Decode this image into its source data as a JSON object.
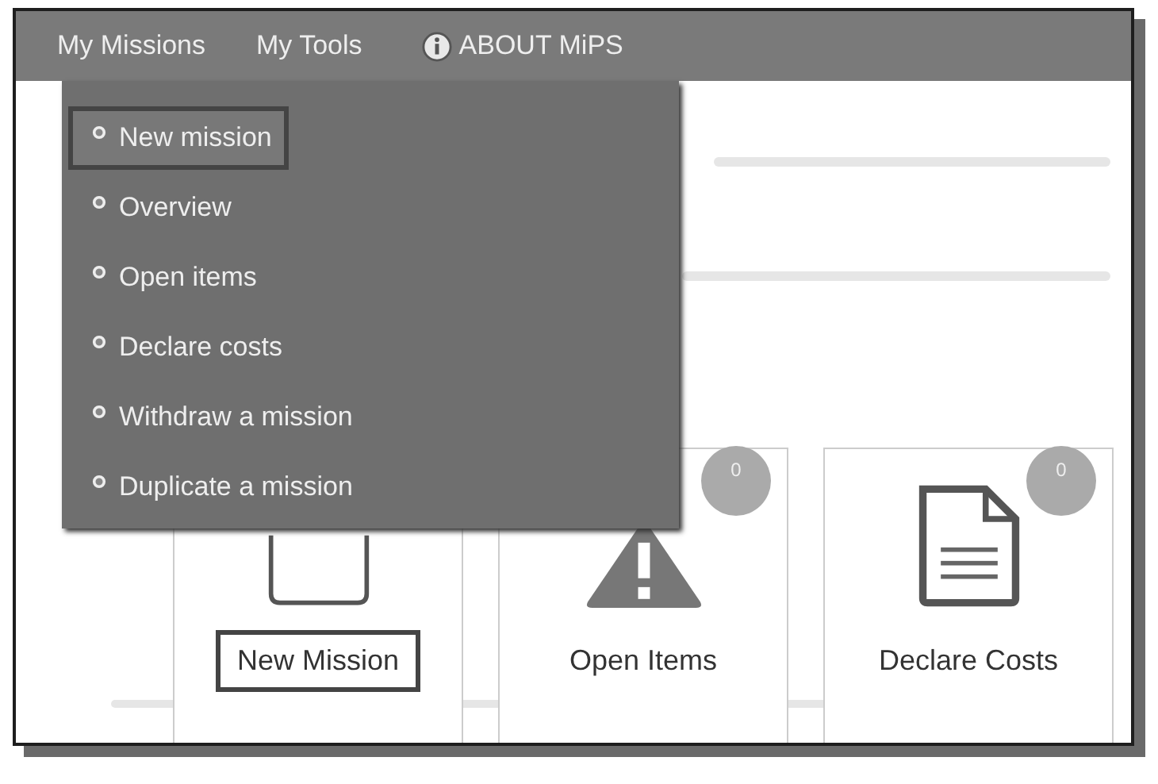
{
  "nav": [
    {
      "label": "My Missions",
      "kind": "text"
    },
    {
      "label": "My Tools",
      "kind": "text"
    },
    {
      "label": "ABOUT MiPS",
      "kind": "info"
    }
  ],
  "menu": [
    {
      "label": "New mission",
      "selected": true
    },
    {
      "label": "Overview",
      "selected": false
    },
    {
      "label": "Open items",
      "selected": false
    },
    {
      "label": "Declare costs",
      "selected": false
    },
    {
      "label": "Withdraw a mission",
      "selected": false
    },
    {
      "label": "Duplicate a mission",
      "selected": false
    }
  ],
  "cards": [
    {
      "label": "New Mission",
      "kind": "blank",
      "selected": true
    },
    {
      "label": "Open Items",
      "kind": "warning",
      "selected": false,
      "badge": "0"
    },
    {
      "label": "Declare Costs",
      "kind": "document",
      "selected": false,
      "badge": "0"
    }
  ]
}
